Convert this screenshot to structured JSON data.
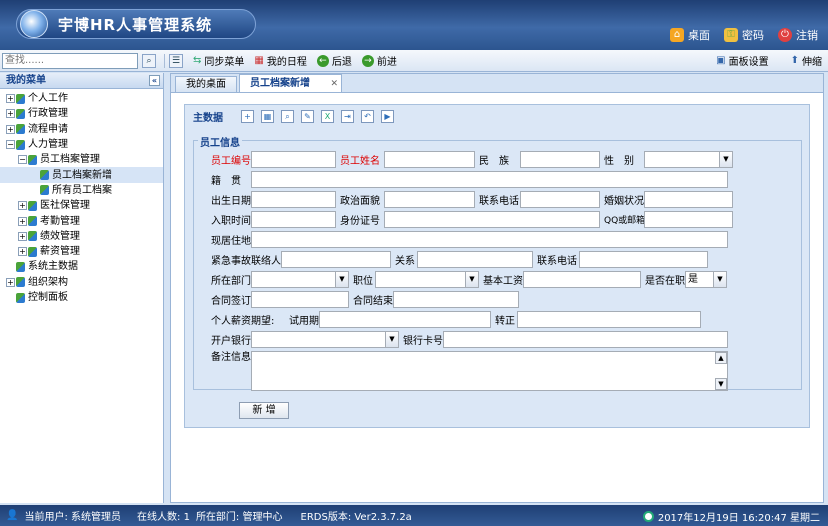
{
  "header": {
    "app_title": "宇博HR人事管理系统",
    "links": [
      {
        "label": "桌面",
        "icon": "home-icon"
      },
      {
        "label": "密码",
        "icon": "key-icon"
      },
      {
        "label": "注销",
        "icon": "power-icon"
      }
    ]
  },
  "toolbar": {
    "search_placeholder": "查找......",
    "sync_menu": "同步菜单",
    "my_schedule": "我的日程",
    "back": "后退",
    "forward": "前进",
    "panel_settings": "面板设置",
    "stretch": "伸缩"
  },
  "sidebar": {
    "title": "我的菜单",
    "items": [
      {
        "label": "个人工作",
        "expander": "+"
      },
      {
        "label": "行政管理",
        "expander": "+"
      },
      {
        "label": "流程申请",
        "expander": "+"
      },
      {
        "label": "人力管理",
        "expander": "−"
      },
      {
        "label": "员工档案管理",
        "expander": "−"
      },
      {
        "label": "员工档案新增",
        "expander": ""
      },
      {
        "label": "所有员工档案",
        "expander": ""
      },
      {
        "label": "医社保管理",
        "expander": "+"
      },
      {
        "label": "考勤管理",
        "expander": "+"
      },
      {
        "label": "绩效管理",
        "expander": "+"
      },
      {
        "label": "薪资管理",
        "expander": "+"
      },
      {
        "label": "系统主数据",
        "expander": ""
      },
      {
        "label": "组织架构",
        "expander": "+"
      },
      {
        "label": "控制面板",
        "expander": ""
      }
    ]
  },
  "tabs": [
    {
      "label": "我的桌面"
    },
    {
      "label": "员工档案新增"
    }
  ],
  "panel": {
    "title": "主数据",
    "section": "员工信息",
    "submit": "新 增"
  },
  "form": {
    "emp_no": "员工编号",
    "emp_name": "员工姓名",
    "ethnicity": "民　族",
    "gender": "性　别",
    "native_place": "籍　贯",
    "birth_date": "出生日期",
    "political": "政治面貌",
    "contact_phone": "联系电话",
    "marital": "婚姻状况",
    "hire_date": "入职时间",
    "id_no": "身份证号",
    "qq_email": "QQ或邮箱",
    "address": "现居住地",
    "emergency_contact": "紧急事故联络人",
    "relation": "关系",
    "emergency_phone": "联系电话",
    "department": "所在部门",
    "position": "职位",
    "base_salary": "基本工资",
    "on_duty": "是否在职",
    "on_duty_value": "是",
    "contract_sign": "合同签订",
    "contract_end": "合同结束",
    "expected_salary": "个人薪资期望:",
    "probation": "试用期",
    "regular": "转正",
    "bank": "开户银行",
    "bank_card": "银行卡号",
    "remarks": "备注信息"
  },
  "statusbar": {
    "current_user": "当前用户: 系统管理员",
    "online_users": "在线人数: 1",
    "department": "所在部门: 管理中心",
    "version": "ERDS版本: Ver2.3.7.2a",
    "datetime": "2017年12月19日 16:20:47 星期二"
  }
}
